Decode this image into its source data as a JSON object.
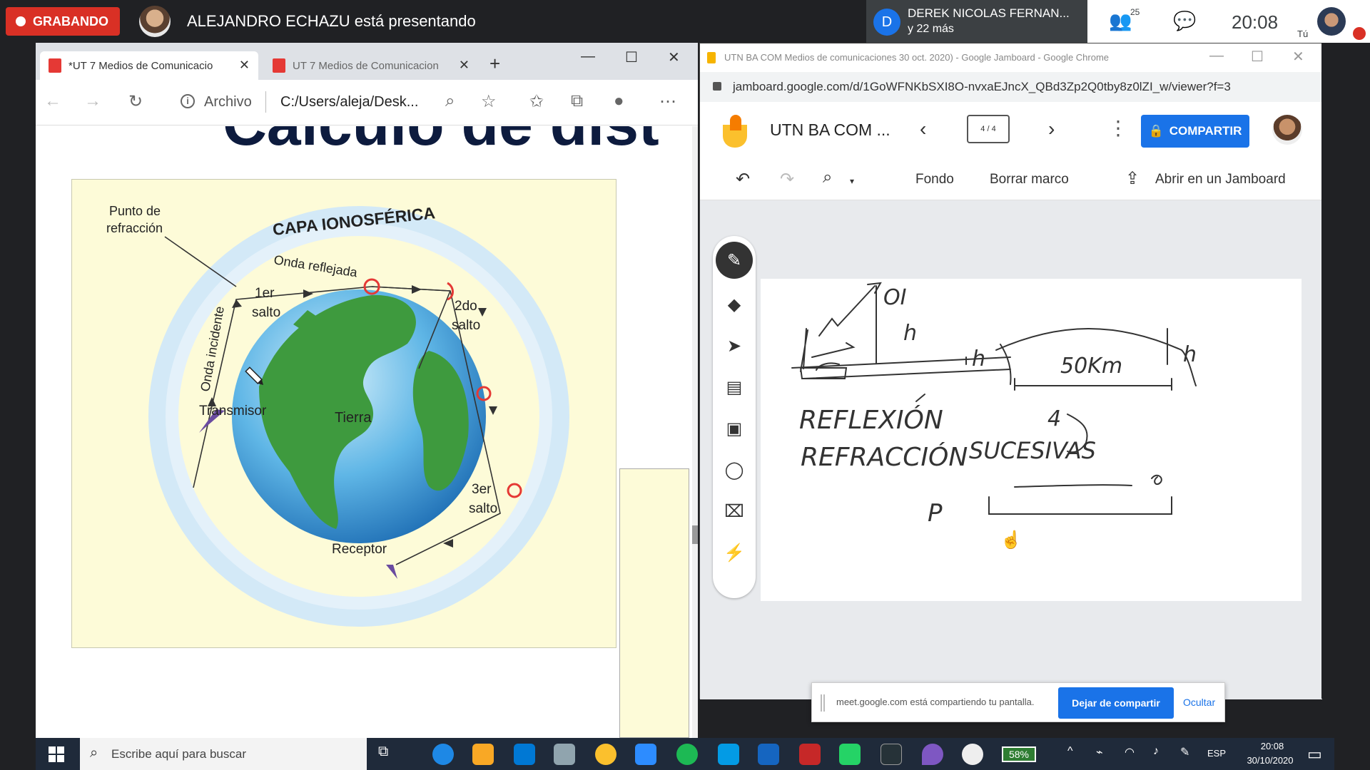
{
  "meet": {
    "recording_label": "GRABANDO",
    "presenting_text": "ALEJANDRO ECHAZU está presentando",
    "participant_initial": "D",
    "participant_name": "DEREK NICOLAS FERNAN...",
    "participant_more": "y 22 más",
    "people_count": "25",
    "clock": "20:08",
    "self_label": "Tú"
  },
  "edge": {
    "tabs": [
      {
        "label": "*UT 7 Medios de Comunicacio"
      },
      {
        "label": "UT 7 Medios de Comunicacion"
      }
    ],
    "archivo_label": "Archivo",
    "address": "C:/Users/aleja/Desk...",
    "slide_title": "Cálculo de dist",
    "diagram": {
      "refraction_point": [
        "Punto de",
        "refracción"
      ],
      "layer": "CAPA IONOSFÉRICA",
      "reflected_wave": "Onda reflejada",
      "incident_wave": "Onda incidente",
      "first_hop": [
        "1er",
        "salto"
      ],
      "second_hop": [
        "2do",
        "salto"
      ],
      "third_hop": [
        "3er",
        "salto"
      ],
      "transmitter": "Transmisor",
      "earth": "Tierra",
      "receiver": "Receptor"
    }
  },
  "jamboard": {
    "window_title": "UTN BA COM Medios de comunicaciones 30 oct. 2020) - Google Jamboard - Google Chrome",
    "url": "jamboard.google.com/d/1GoWFNKbSXI8O-nvxaEJncX_QBd3Zp2Q0tby8z0lZI_w/viewer?f=3",
    "doc_title": "UTN BA COM ...",
    "frame_counter": "4 / 4",
    "share_label": "COMPARTIR",
    "toolbar": {
      "background": "Fondo",
      "clear_frame": "Borrar marco",
      "open_in_jamboard": "Abrir en un Jamboard"
    },
    "handwriting": {
      "oi": "OI",
      "h1": "h",
      "h2": "h",
      "h3": "h",
      "distance": "50Km",
      "line1": "REFLEXIÓN",
      "line2": "REFRACCIÓN",
      "word3": "SUCESIVAS",
      "num": "4",
      "p": "P"
    }
  },
  "share_bar": {
    "text": "meet.google.com está compartiendo tu pantalla.",
    "stop": "Dejar de compartir",
    "hide": "Ocultar"
  },
  "taskbar": {
    "search_placeholder": "Escribe aquí para buscar",
    "battery": "58%",
    "language": "ESP",
    "time": "20:08",
    "date": "30/10/2020"
  },
  "colors": {
    "recording_red": "#d93025",
    "google_blue": "#1a73e8",
    "slide_bg": "#fdfbd8"
  }
}
